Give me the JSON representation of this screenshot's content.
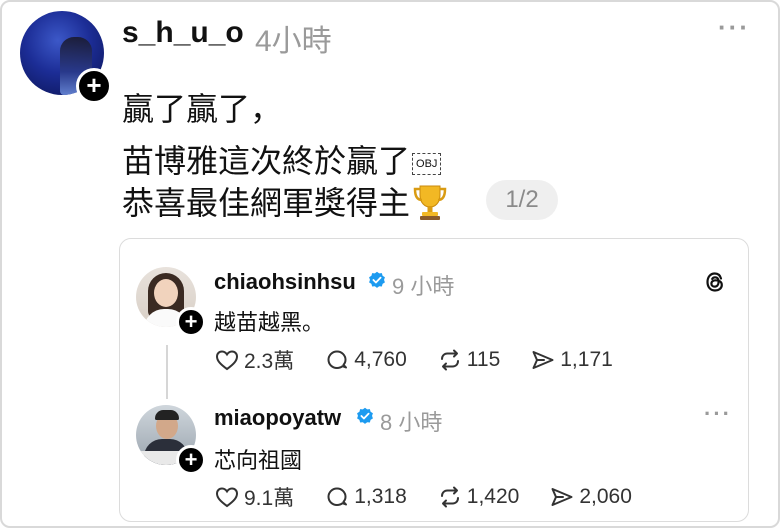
{
  "post": {
    "username": "s_h_u_o",
    "time": "4小時",
    "lines": [
      "贏了贏了，",
      "苗博雅這次終於贏了",
      "恭喜最佳網軍獎得主"
    ],
    "obj_placeholder": "OBJ",
    "page_indicator": "1/2",
    "more_label": "···",
    "plus_label": "+"
  },
  "quoted": [
    {
      "username": "chiaohsinhsu",
      "time": "9 小時",
      "text": "越苗越黑。",
      "likes": "2.3萬",
      "comments": "4,760",
      "reposts": "115",
      "shares": "1,171"
    },
    {
      "username": "miaopoyatw",
      "time": "8 小時",
      "text": "芯向祖國",
      "likes": "9.1萬",
      "comments": "1,318",
      "reposts": "1,420",
      "shares": "2,060"
    }
  ],
  "icons": {
    "verified": "verified-badge-icon",
    "threads": "threads-logo-icon",
    "trophy": "trophy-emoji-icon"
  },
  "colors": {
    "verified": "#1d9bf0",
    "muted": "#9a9a9a",
    "text": "#111111"
  }
}
